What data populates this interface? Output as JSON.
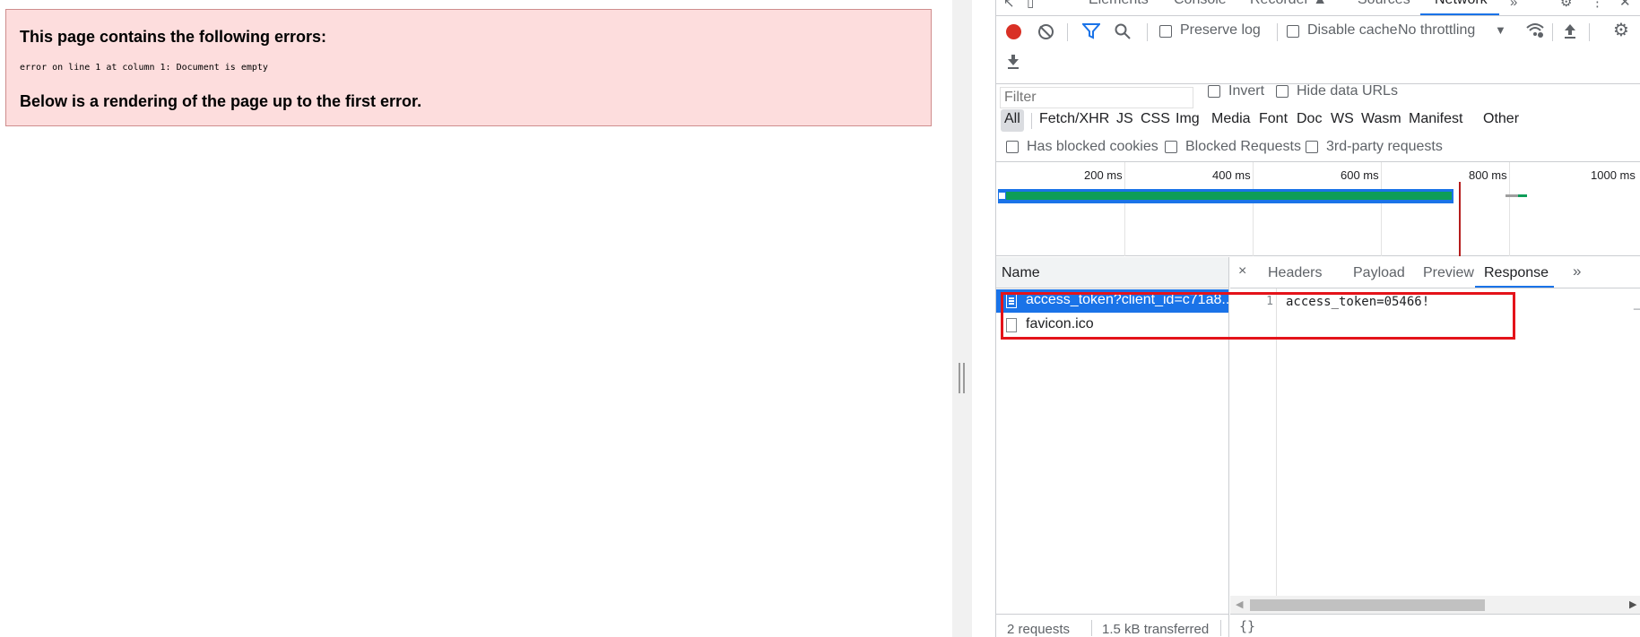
{
  "page": {
    "error_title": "This page contains the following errors:",
    "error_message": "error on line 1 at column 1: Document is empty",
    "error_below": "Below is a rendering of the page up to the first error."
  },
  "devtools": {
    "tabs": [
      "Elements",
      "Console",
      "Recorder ▲",
      "Sources",
      "Network"
    ],
    "active_tab": "Network",
    "toolbar": {
      "preserve_log": "Preserve log",
      "disable_cache": "Disable cache",
      "throttling": "No throttling",
      "throttling_arrow": "▼"
    },
    "filter": {
      "placeholder": "Filter",
      "invert": "Invert",
      "hide_data_urls": "Hide data URLs",
      "types": [
        "All",
        "Fetch/XHR",
        "JS",
        "CSS",
        "Img",
        "Media",
        "Font",
        "Doc",
        "WS",
        "Wasm",
        "Manifest",
        "Other"
      ],
      "active_type": "All",
      "has_blocked_cookies": "Has blocked cookies",
      "blocked_requests": "Blocked Requests",
      "third_party": "3rd-party requests"
    },
    "overview": {
      "ticks": [
        "200 ms",
        "400 ms",
        "600 ms",
        "800 ms",
        "1000 ms"
      ]
    },
    "requests": {
      "header": "Name",
      "items": [
        {
          "name": "access_token?client_id=c71a8...",
          "selected": true
        },
        {
          "name": "favicon.ico",
          "selected": false
        }
      ],
      "footer_count": "2 requests",
      "footer_transferred": "1.5 kB transferred"
    },
    "detail": {
      "close": "×",
      "tabs": [
        "Headers",
        "Payload",
        "Preview",
        "Response"
      ],
      "active_tab": "Response",
      "more": "»",
      "line_number": "1",
      "response_text": "access_token=05466!",
      "footer_format": "{}"
    }
  },
  "colors": {
    "accent": "#1a73e8",
    "error_bg": "#fddddd",
    "record_red": "#d93025",
    "highlight_red": "#e4131a"
  }
}
